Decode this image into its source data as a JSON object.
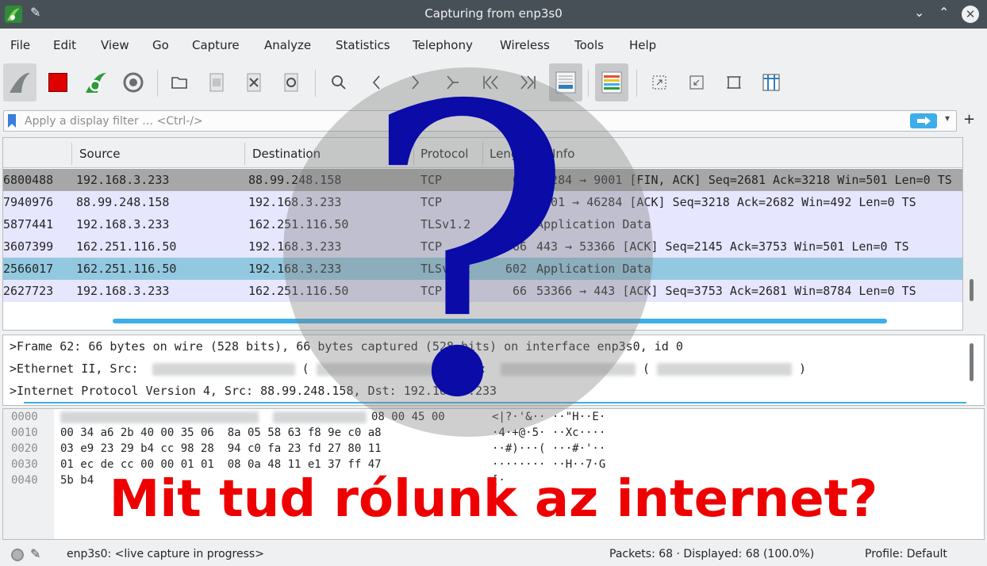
{
  "window": {
    "title": "Capturing from enp3s0"
  },
  "menu": [
    "File",
    "Edit",
    "View",
    "Go",
    "Capture",
    "Analyze",
    "Statistics",
    "Telephony",
    "Wireless",
    "Tools",
    "Help"
  ],
  "filter": {
    "placeholder": "Apply a display filter … <Ctrl-/>"
  },
  "packet_list": {
    "columns": [
      "Source",
      "Destination",
      "Protocol",
      "Length",
      "Info"
    ],
    "rows": [
      {
        "time": "6800488",
        "source": "192.168.3.233",
        "destination": "88.99.248.158",
        "protocol": "TCP",
        "length": "66",
        "info": "46284 → 9001 [FIN, ACK] Seq=2681 Ack=3218 Win=501 Len=0 TS",
        "bg": "#a7a7a7",
        "fg": "#232627"
      },
      {
        "time": "7940976",
        "source": "88.99.248.158",
        "destination": "192.168.3.233",
        "protocol": "TCP",
        "length": "66",
        "info": "9001 → 46284 [ACK] Seq=3218 Ack=2682 Win=492 Len=0 TS",
        "bg": "#e7e6ff",
        "fg": "#232627"
      },
      {
        "time": "5877441",
        "source": "192.168.3.233",
        "destination": "162.251.116.50",
        "protocol": "TLSv1.2",
        "length": "183",
        "info": "Application Data",
        "bg": "#e7e6ff",
        "fg": "#232627"
      },
      {
        "time": "3607399",
        "source": "162.251.116.50",
        "destination": "192.168.3.233",
        "protocol": "TCP",
        "length": "66",
        "info": "443 → 53366 [ACK] Seq=2145 Ack=3753 Win=501 Len=0 TS",
        "bg": "#e7e6ff",
        "fg": "#232627"
      },
      {
        "time": "2566017",
        "source": "162.251.116.50",
        "destination": "192.168.3.233",
        "protocol": "TLSv1.2",
        "length": "602",
        "info": "Application Data",
        "bg": "#93c9e0",
        "fg": "#232627"
      },
      {
        "time": "2627723",
        "source": "192.168.3.233",
        "destination": "162.251.116.50",
        "protocol": "TCP",
        "length": "66",
        "info": "53366 → 443 [ACK] Seq=3753 Ack=2681 Win=8784 Len=0 TS",
        "bg": "#e7e6ff",
        "fg": "#232627"
      }
    ]
  },
  "details": {
    "lines": [
      "Frame 62: 66 bytes on wire (528 bits), 66 bytes captured (528 bits) on interface enp3s0, id 0",
      "Ethernet II, Src:",
      "Internet Protocol Version 4, Src: 88.99.248.158, Dst: 192.168.3.233"
    ],
    "ethernet_dst_label": "Dst:"
  },
  "bytes": {
    "offsets": [
      "0000",
      "0010",
      "0020",
      "0030",
      "0040"
    ],
    "hex": [
      "08 00 45 00",
      "00 34 a6 2b 40 00 35 06  8a 05 58 63 f8 9e c0 a8",
      "03 e9 23 29 b4 cc 98 28  94 c0 fa 23 fd 27 80 11",
      "01 ec de cc 00 00 01 01  08 0a 48 11 e1 37 ff 47",
      "5b b4"
    ],
    "ascii": [
      "<|?·'&·· ··\"H··E·",
      "·4·+@·5· ··Xc····",
      "··#)···( ···#·'··",
      "········ ··H··7·G",
      "[·"
    ]
  },
  "status": {
    "capture": "enp3s0: <live capture in progress>",
    "packets": "Packets: 68 · Displayed: 68 (100.0%)",
    "profile": "Profile: Default"
  },
  "overlay": {
    "question": "?",
    "banner": "Mit tud rólunk az internet?"
  },
  "colors": {
    "selected_row": "#93c9e0",
    "accent": "#3daee9",
    "banner": "#ee0000",
    "question": "#0b0ba8"
  }
}
